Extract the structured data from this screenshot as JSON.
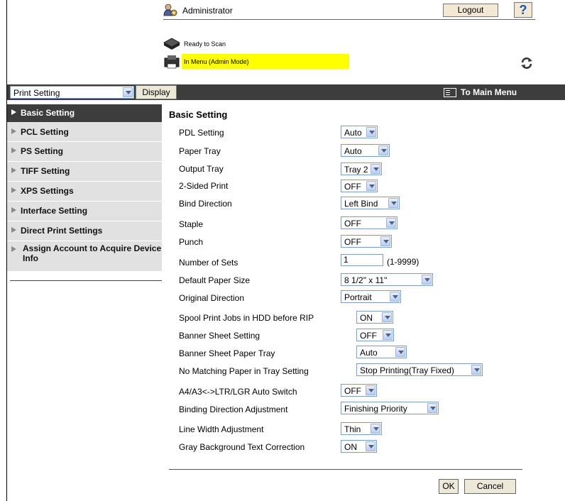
{
  "header": {
    "user_label": "Administrator",
    "logout_label": "Logout",
    "help_label": "?"
  },
  "status": {
    "scan_status": "Ready to Scan",
    "mode_status": "In Menu (Admin Mode)",
    "mode_highlight_color": "#ffff00"
  },
  "toolbar": {
    "mode_select_value": "Print Setting",
    "display_label": "Display",
    "to_main_menu": "To Main Menu"
  },
  "sidebar": {
    "items": [
      {
        "label": "Basic Setting",
        "active": true
      },
      {
        "label": "PCL Setting",
        "active": false
      },
      {
        "label": "PS Setting",
        "active": false
      },
      {
        "label": "TIFF Setting",
        "active": false
      },
      {
        "label": "XPS Settings",
        "active": false
      },
      {
        "label": "Interface Setting",
        "active": false
      },
      {
        "label": "Direct Print Settings",
        "active": false
      },
      {
        "label": "Assign Account to Acquire Device Info",
        "active": false
      }
    ]
  },
  "main": {
    "title": "Basic Setting",
    "rows": [
      {
        "label": "PDL Setting",
        "value": "Auto"
      },
      {
        "label": "Paper Tray",
        "value": "Auto"
      },
      {
        "label": "Output Tray",
        "value": "Tray 2"
      },
      {
        "label": "2-Sided Print",
        "value": "OFF"
      },
      {
        "label": "Bind Direction",
        "value": "Left Bind"
      },
      {
        "label": "Staple",
        "value": "OFF"
      },
      {
        "label": "Punch",
        "value": "OFF"
      },
      {
        "label": "Number of Sets",
        "value": "1",
        "hint": "(1-9999)"
      },
      {
        "label": "Default Paper Size",
        "value": "8 1/2\" x 11\""
      },
      {
        "label": "Original Direction",
        "value": "Portrait"
      },
      {
        "label": "Spool Print Jobs in HDD before RIP",
        "value": "ON"
      },
      {
        "label": "Banner Sheet Setting",
        "value": "OFF"
      },
      {
        "label": "Banner Sheet Paper Tray",
        "value": "Auto"
      },
      {
        "label": "No Matching Paper in Tray Setting",
        "value": "Stop Printing(Tray Fixed)"
      },
      {
        "label": "A4/A3<->LTR/LGR Auto Switch",
        "value": "OFF"
      },
      {
        "label": "Binding Direction Adjustment",
        "value": "Finishing Priority"
      },
      {
        "label": "Line Width Adjustment",
        "value": "Thin"
      },
      {
        "label": "Gray Background Text Correction",
        "value": "ON"
      }
    ],
    "ok_label": "OK",
    "cancel_label": "Cancel"
  },
  "icons": {
    "admin": "admin-user-icon",
    "scanner": "scanner-icon",
    "printer": "printer-icon",
    "refresh": "refresh-icon",
    "to_main": "menu-icon"
  }
}
